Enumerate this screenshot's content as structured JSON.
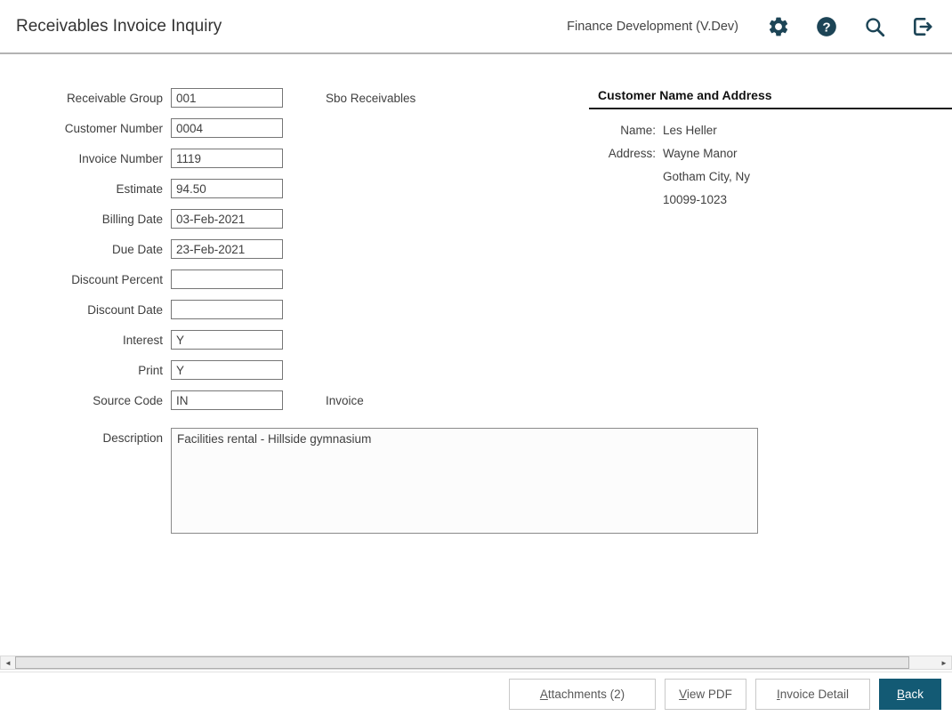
{
  "header": {
    "title": "Receivables Invoice Inquiry",
    "environment": "Finance Development (V.Dev)"
  },
  "form": {
    "fields": [
      {
        "label": "Receivable Group",
        "value": "001",
        "suffix": "Sbo Receivables"
      },
      {
        "label": "Customer Number",
        "value": "0004"
      },
      {
        "label": "Invoice Number",
        "value": "1119"
      },
      {
        "label": "Estimate",
        "value": "94.50"
      },
      {
        "label": "Billing Date",
        "value": "03-Feb-2021"
      },
      {
        "label": "Due Date",
        "value": "23-Feb-2021"
      },
      {
        "label": "Discount Percent",
        "value": ""
      },
      {
        "label": "Discount Date",
        "value": ""
      },
      {
        "label": "Interest",
        "value": "Y"
      },
      {
        "label": "Print",
        "value": "Y"
      },
      {
        "label": "Source Code",
        "value": "IN",
        "suffix": "Invoice"
      }
    ],
    "description": {
      "label": "Description",
      "value": "Facilities rental - Hillside gymnasium"
    }
  },
  "customer": {
    "title": "Customer Name and Address",
    "name_label": "Name:",
    "name": "Les Heller",
    "address_label": "Address:",
    "address_line1": "Wayne Manor",
    "address_line2": "Gotham City, Ny",
    "address_line3": "10099-1023"
  },
  "footer": {
    "buttons": [
      {
        "key": "A",
        "rest": "ttachments (2)"
      },
      {
        "key": "V",
        "rest": "iew PDF"
      },
      {
        "key": "I",
        "rest": "nvoice Detail"
      },
      {
        "key": "B",
        "rest": "ack"
      }
    ]
  },
  "colors": {
    "accent": "#135a74",
    "icon": "#1c4456"
  }
}
